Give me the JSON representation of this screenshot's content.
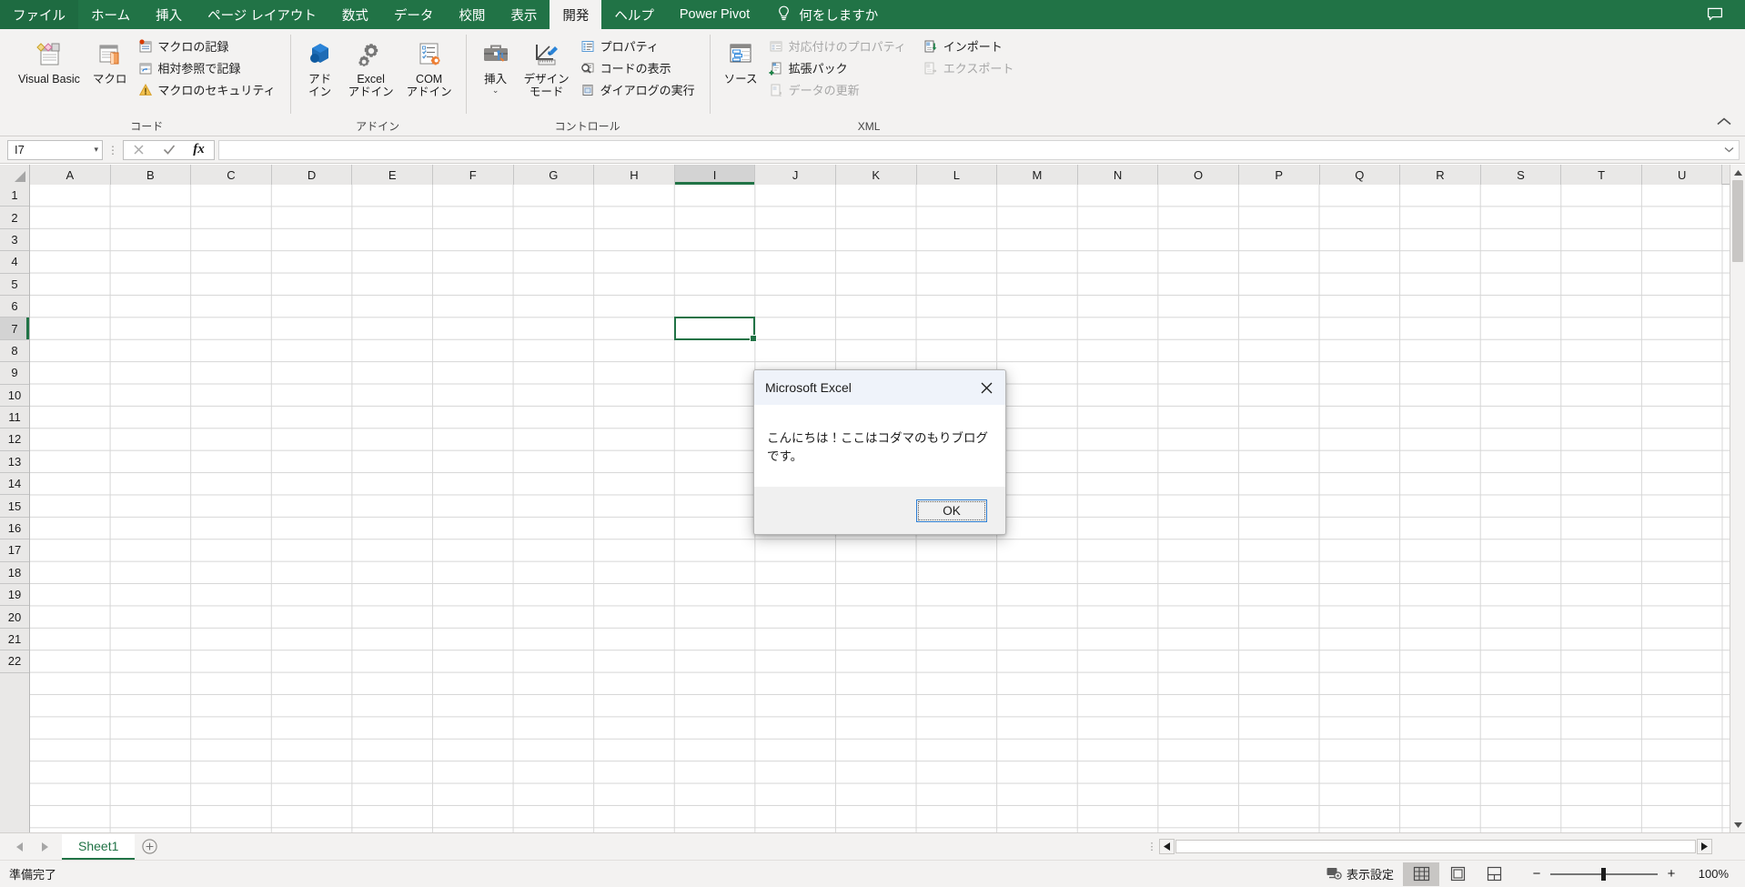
{
  "app": {
    "title": "Microsoft Excel"
  },
  "tabs": [
    {
      "label": "ファイル",
      "active": false
    },
    {
      "label": "ホーム",
      "active": false
    },
    {
      "label": "挿入",
      "active": false
    },
    {
      "label": "ページ レイアウト",
      "active": false
    },
    {
      "label": "数式",
      "active": false
    },
    {
      "label": "データ",
      "active": false
    },
    {
      "label": "校閲",
      "active": false
    },
    {
      "label": "表示",
      "active": false
    },
    {
      "label": "開発",
      "active": true
    },
    {
      "label": "ヘルプ",
      "active": false
    },
    {
      "label": "Power Pivot",
      "active": false
    }
  ],
  "tellme": {
    "label": "何をしますか",
    "icon": "lightbulb-icon"
  },
  "comment_button": {
    "icon": "comment-icon"
  },
  "ribbon": {
    "collapse_icon": "chevron-up-icon",
    "groups": [
      {
        "label": "コード",
        "big_buttons": [
          {
            "label": "Visual Basic",
            "icon": "visual-basic-icon"
          },
          {
            "label": "マクロ",
            "icon": "macro-icon"
          }
        ],
        "small_buttons": [
          {
            "label": "マクロの記録",
            "icon": "record-macro-icon",
            "disabled": false
          },
          {
            "label": "相対参照で記録",
            "icon": "relative-reference-icon",
            "disabled": false
          },
          {
            "label": "マクロのセキュリティ",
            "icon": "macro-security-icon",
            "disabled": false
          }
        ]
      },
      {
        "label": "アドイン",
        "big_buttons": [
          {
            "label": "アド\nイン",
            "icon": "addins-icon"
          },
          {
            "label": "Excel\nアドイン",
            "icon": "excel-addins-icon"
          },
          {
            "label": "COM\nアドイン",
            "icon": "com-addins-icon"
          }
        ],
        "small_buttons": []
      },
      {
        "label": "コントロール",
        "big_buttons": [
          {
            "label": "挿入",
            "icon": "insert-control-icon",
            "caret": "⌄"
          },
          {
            "label": "デザイン\nモード",
            "icon": "design-mode-icon"
          }
        ],
        "small_buttons": [
          {
            "label": "プロパティ",
            "icon": "properties-icon",
            "disabled": false
          },
          {
            "label": "コードの表示",
            "icon": "view-code-icon",
            "disabled": false
          },
          {
            "label": "ダイアログの実行",
            "icon": "run-dialog-icon",
            "disabled": false
          }
        ]
      },
      {
        "label": "XML",
        "big_buttons": [
          {
            "label": "ソース",
            "icon": "xml-source-icon"
          }
        ],
        "small_buttons": [
          {
            "label": "対応付けのプロパティ",
            "icon": "map-properties-icon",
            "disabled": true
          },
          {
            "label": "拡張パック",
            "icon": "expansion-pack-icon",
            "disabled": false
          },
          {
            "label": "データの更新",
            "icon": "refresh-data-icon",
            "disabled": true
          }
        ],
        "small_buttons2": [
          {
            "label": "インポート",
            "icon": "import-icon",
            "disabled": false
          },
          {
            "label": "エクスポート",
            "icon": "export-icon",
            "disabled": true
          }
        ]
      }
    ]
  },
  "formula_bar": {
    "name_box_value": "I7",
    "name_box_caret": "▾",
    "cancel_icon": "cancel-x-icon",
    "enter_icon": "enter-check-icon",
    "function_icon": "fx-icon",
    "formula_value": "",
    "expand_icon": "chevron-down-icon"
  },
  "grid": {
    "columns": [
      "A",
      "B",
      "C",
      "D",
      "E",
      "F",
      "G",
      "H",
      "I",
      "J",
      "K",
      "L",
      "M",
      "N",
      "O",
      "P",
      "Q",
      "R",
      "S",
      "T",
      "U"
    ],
    "rows": [
      "1",
      "2",
      "3",
      "4",
      "5",
      "6",
      "7",
      "8",
      "9",
      "10",
      "11",
      "12",
      "13",
      "14",
      "15",
      "16",
      "17",
      "18",
      "19",
      "20",
      "21",
      "22"
    ],
    "active_column": "I",
    "active_row": "7",
    "selected_cell": "I7"
  },
  "sheet_bar": {
    "prev_icon": "triangle-left-icon",
    "next_icon": "triangle-right-icon",
    "tabs": [
      {
        "label": "Sheet1",
        "active": true
      }
    ],
    "add_sheet_icon": "plus-circle-icon",
    "scroll_left_icon": "triangle-left-icon",
    "scroll_right_icon": "triangle-right-icon"
  },
  "status_bar": {
    "status_text": "準備完了",
    "display_settings_label": "表示設定",
    "display_settings_icon": "display-settings-icon",
    "views": [
      {
        "name": "normal-view",
        "icon": "grid-view-icon",
        "selected": true
      },
      {
        "name": "page-layout-view",
        "icon": "page-layout-icon",
        "selected": false
      },
      {
        "name": "page-break-view",
        "icon": "page-break-icon",
        "selected": false
      }
    ],
    "zoom_out": "−",
    "zoom_in": "+",
    "zoom_value": "100%"
  },
  "dialog": {
    "title": "Microsoft Excel",
    "close_icon": "close-x-icon",
    "message": "こんにちは！ここはコダマのもりブログです。",
    "ok_label": "OK"
  },
  "colors": {
    "brand_green": "#217346",
    "ribbon_bg": "#f3f2f1",
    "dialog_title_bg": "#eff3fa",
    "focus_blue": "#2d7dd2"
  }
}
